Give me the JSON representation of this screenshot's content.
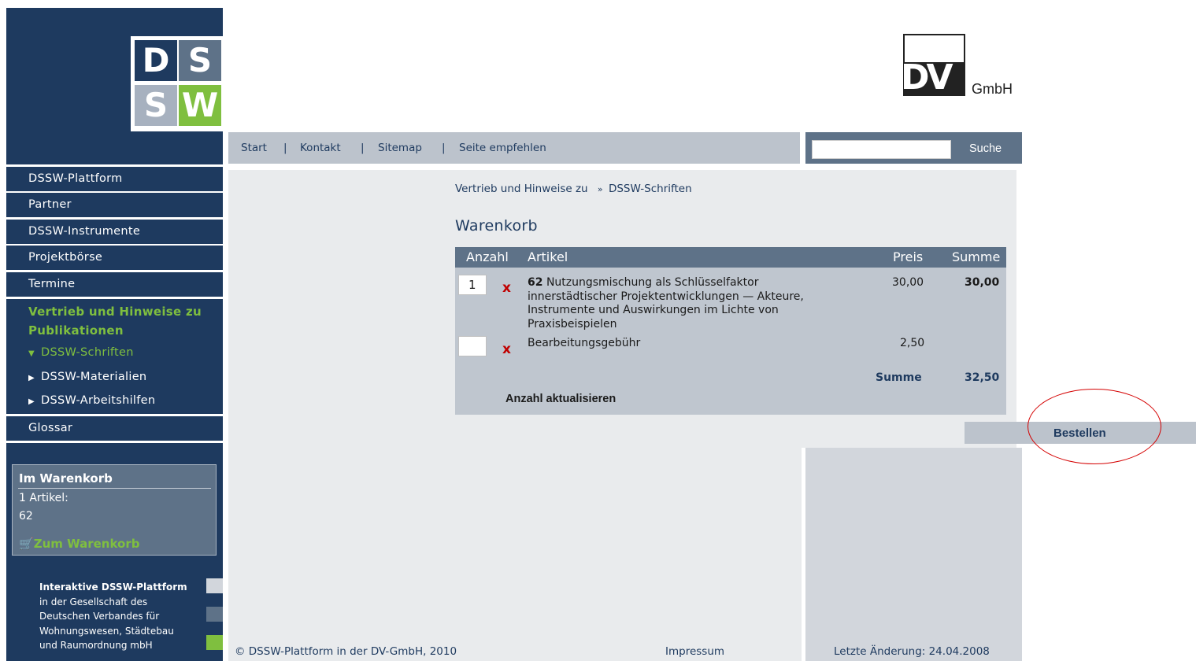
{
  "logos": {
    "dssw": [
      "D",
      "S",
      "S",
      "W"
    ],
    "dv": "DV",
    "dv_suffix": "GmbH"
  },
  "sidebar": {
    "items": [
      {
        "label": "DSSW-Plattform"
      },
      {
        "label": "Partner"
      },
      {
        "label": "DSSW-Instrumente"
      },
      {
        "label": "Projektbörse"
      },
      {
        "label": "Termine"
      }
    ],
    "active_section": "Vertrieb und Hinweise zu Publikationen",
    "subitems": [
      {
        "label": "DSSW-Schriften",
        "active": true
      },
      {
        "label": "DSSW-Materialien",
        "active": false
      },
      {
        "label": "DSSW-Arbeitshilfen",
        "active": false
      }
    ],
    "glossar": "Glossar",
    "cart_widget": {
      "title": "Im Warenkorb",
      "count": "1 Artikel:",
      "item": "62",
      "link": "Zum Warenkorb"
    },
    "footer": {
      "title": "Interaktive DSSW-Plattform",
      "lines": [
        "in der Gesellschaft des",
        "Deutschen Verbandes für",
        "Wohnungswesen, Städtebau",
        "und Raumordnung mbH"
      ]
    }
  },
  "topnav": {
    "links": [
      "Start",
      "Kontakt",
      "Sitemap",
      "Seite empfehlen"
    ],
    "separator": "|"
  },
  "search": {
    "button": "Suche",
    "value": ""
  },
  "breadcrumb": {
    "part1": "Vertrieb und Hinweise zu",
    "separator": "»",
    "part2": "DSSW-Schriften"
  },
  "page_title": "Warenkorb",
  "cart": {
    "columns": {
      "anzahl": "Anzahl",
      "artikel": "Artikel",
      "preis": "Preis",
      "summe": "Summe"
    },
    "rows": [
      {
        "qty": "1",
        "number": "62",
        "lines": [
          "Nutzungsmischung als Schlüsselfaktor",
          "innerstädtischer Projektentwicklungen — Akteure,",
          "Instrumente und Auswirkungen im Lichte von",
          "Praxisbeispielen"
        ],
        "price": "30,00",
        "sum": "30,00"
      },
      {
        "qty": "",
        "number": "",
        "lines": [
          "Bearbeitungsgebühr"
        ],
        "price": "2,50",
        "sum": ""
      }
    ],
    "delete_glyph": "x",
    "total_label": "Summe",
    "total_value": "32,50",
    "update_label": "Anzahl aktualisieren"
  },
  "order_button": "Bestellen",
  "footer": {
    "copyright": "© DSSW-Plattform in der DV-GmbH, 2010",
    "impressum": "Impressum",
    "last_change": "Letzte Änderung: 24.04.2008"
  },
  "colors": {
    "navy": "#1e3a5f",
    "slate": "#5e7288",
    "green": "#7fbf3f",
    "red": "#d40000"
  }
}
